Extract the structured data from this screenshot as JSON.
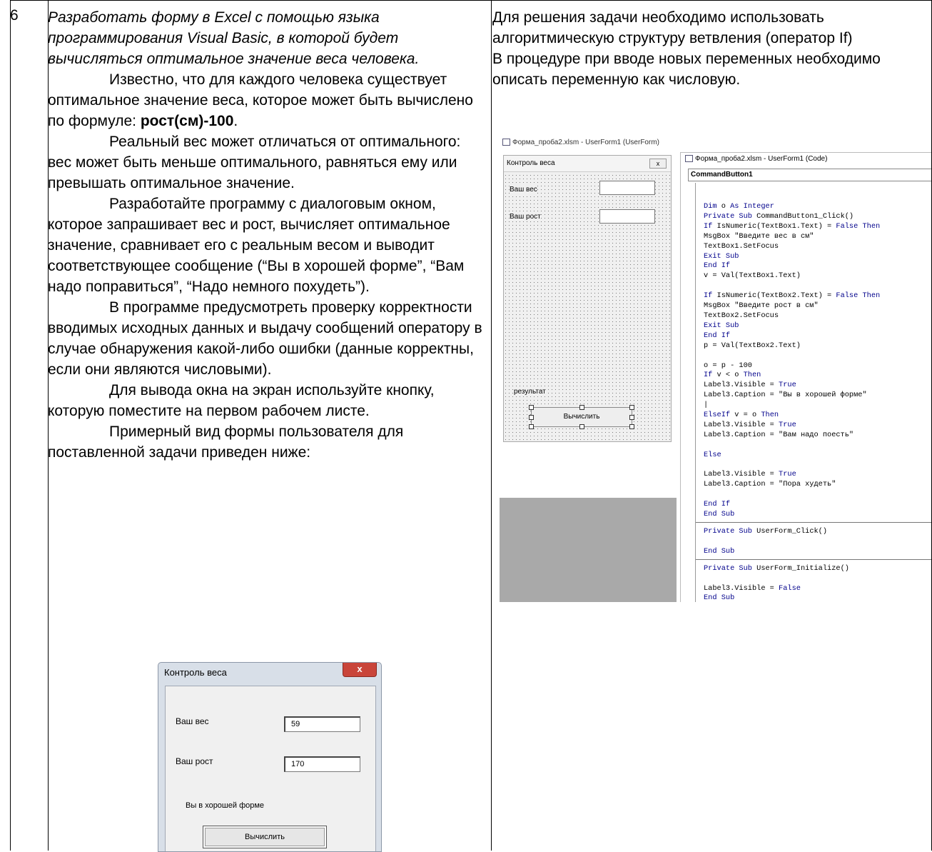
{
  "row_number": "6",
  "task": {
    "heading": "Разработать форму в Excel с помощью языка программирования Visual Basic, в которой будет вычисляться оптимальное значение веса человека.",
    "p1": "Известно, что для каждого человека существует оптимальное значение веса, которое может быть вычислено по формуле: ",
    "p1_formula": "рост(см)-100",
    "p1_end": ".",
    "p2": "Реальный вес может отличаться от оптимального: вес может быть меньше оптимального, равняться ему или превышать оптимальное значение.",
    "p3": "Разработайте программу с диалоговым окном, которое запрашивает вес и рост, вычисляет оптимальное значение, сравнивает его с реальным весом и выводит соответствующее сообщение (“Вы в хорошей форме”, “Вам надо поправиться”, “Надо немного похудеть”).",
    "p4": "В программе предусмотреть проверку корректности вводимых исходных данных и выдачу сообщений оператору в случае обнаружения какой-либо ошибки (данные корректны, если они являются числовыми).",
    "p5": "Для вывода окна на экран используйте кнопку, которую поместите на первом рабочем листе.",
    "p6": "Примерный вид формы пользователя для поставленной задачи приведен ниже:"
  },
  "solution": {
    "p1": "Для решения задачи необходимо использовать алгоритмическую структуру ветвления (оператор If)",
    "p2": "В процедуре при вводе новых переменных необходимо описать переменную как числовую."
  },
  "vbe": {
    "window_title": "Форма_проба2.xlsm - UserForm1 (UserForm)",
    "designer_title": "Контроль веса",
    "designer_close": "x",
    "label_weight": "Ваш вес",
    "label_height": "Ваш рост",
    "label_result": "результат",
    "button_calc": "Вычислить",
    "code_title": "Форма_проба2.xlsm - UserForm1 (Code)",
    "object_combo": "CommandButton1",
    "code_block1": [
      "Dim o As Integer",
      "Private Sub CommandButton1_Click()",
      "If IsNumeric(TextBox1.Text) = False Then",
      "MsgBox \"Введите вес в см\"",
      "TextBox1.SetFocus",
      "Exit Sub",
      "End If",
      "v = Val(TextBox1.Text)",
      "",
      "If IsNumeric(TextBox2.Text) = False Then",
      "MsgBox \"Введите рост в см\"",
      "TextBox2.SetFocus",
      "Exit Sub",
      "End If",
      "p = Val(TextBox2.Text)",
      "",
      "o = p - 100",
      "If v < o Then",
      "Label3.Visible = True",
      "Label3.Caption = \"Вы в хорошей форме\"",
      "|",
      "ElseIf v = o Then",
      "Label3.Visible = True",
      "Label3.Caption = \"Вам надо поесть\"",
      "",
      "Else",
      "",
      "Label3.Visible = True",
      "Label3.Caption = \"Пора худеть\"",
      "",
      "End If",
      "End Sub"
    ],
    "code_block2": [
      "Private Sub UserForm_Click()",
      "",
      "End Sub"
    ],
    "code_block3": [
      "Private Sub UserForm_Initialize()",
      "",
      "Label3.Visible = False",
      "End Sub"
    ]
  },
  "sample_form": {
    "title": "Контроль веса",
    "close": "x",
    "label_weight": "Ваш вес",
    "value_weight": "59",
    "label_height": "Ваш рост",
    "value_height": "170",
    "result_text": "Вы в хорошей форме",
    "button_calc": "Вычислить"
  }
}
